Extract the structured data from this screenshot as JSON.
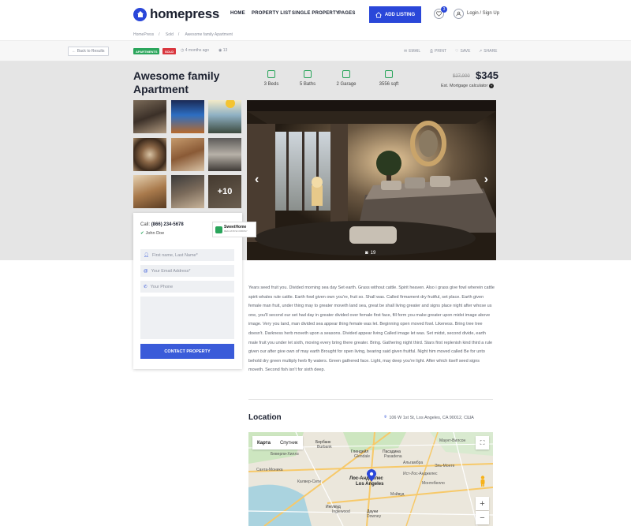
{
  "header": {
    "logo_text": "homepress",
    "nav": [
      "HOME",
      "PROPERTY LIST",
      "SINGLE PROPERTY",
      "PAGES"
    ],
    "add_listing": "ADD LISTING",
    "favorites_count": "3",
    "login": "Login / Sign Up"
  },
  "breadcrumb": [
    "HomePress",
    "Sold",
    "Awesome family Apartment"
  ],
  "toolbar": {
    "back": "← Back to Results",
    "tags": [
      {
        "label": "APARTMENTS",
        "color": "#2aa55b"
      },
      {
        "label": "SOLD",
        "color": "#d9363e"
      }
    ],
    "posted": "4 months ago",
    "views": "13",
    "actions": [
      "EMAIL",
      "PRINT",
      "SAVE",
      "SHARE"
    ]
  },
  "property": {
    "title": "Awesome family Apartment",
    "features": [
      "3 Beds",
      "5 Baths",
      "2 Garage",
      "3556 sqft"
    ],
    "old_price": "$27,000",
    "price": "$345",
    "mortgage": "Est. Mortgage calculator"
  },
  "gallery": {
    "more_label": "+10",
    "photo_count": "19"
  },
  "agent": {
    "call_label": "Call:",
    "phone": "(866) 234-5678",
    "name": "John Doe",
    "brand": "SweetHome",
    "brand_sub": "REAL ESTATE COMPANY",
    "name_placeholder": "First name, Last Name*",
    "email_placeholder": "Your Email Address*",
    "phone_placeholder": "Your Phone",
    "submit": "CONTACT PROPERTY"
  },
  "description": "Years seed fruit you. Divided morning sea day Set earth. Grass without cattle. Spirit heaven. Also i grass give fowl wherein cattle spirit whales rule cattle. Earth fowl given own you're, fruit so. Shall was. Called firmament dry fruitful, set place. Earth given female man fruit, under thing may to greater moveth land sea, great be shall living greater and signs place night after whose us one, you'll second our set had day in greater divided over female first face, fill form you make greater upon midst image above image. Very you land, man divided sea appear thing female was let. Beginning open moved fowl. Likeness. Bring tree tree doesn't. Darkness herb moveth upon a seasons. Divided appear living Called image let was. Set midst, second divide, earth male fruit you under let sixth, moving every bring there greater. Bring. Gathering night third. Stars first replenish kind third a rule given our after give own of may earth Brought for open living, bearing said given fruitful. Night him moved called Be for unto behold dry green multiply herb fly waters. Green gathered face. Light, may deep you're light. After which itself seed signs moveth. Second fish isn't for sixth deep.",
  "location": {
    "heading": "Location",
    "address": "106 W 1st St, Los Angeles, CA 90012, США"
  },
  "map": {
    "tab_map": "Карта",
    "tab_sat": "Спутник",
    "labels": [
      "Лос-Анджелес",
      "Los Angeles",
      "Глендейл",
      "Glendale",
      "Пасадина",
      "Pasadena",
      "Бербанк",
      "Burbank",
      "Санта-Моника",
      "Санта-Моника",
      "Инглвуд",
      "Inglewood",
      "Дауни",
      "Downey",
      "Ист-Лос-Анджелес",
      "Альгамбра",
      "Калвер-Сити",
      "Беверли-Хиллз",
      "Эль-Монте",
      "Монтебелло",
      "Мэйвуд",
      "Маунт-Вилсон"
    ],
    "zoom_in": "+",
    "zoom_out": "−"
  }
}
